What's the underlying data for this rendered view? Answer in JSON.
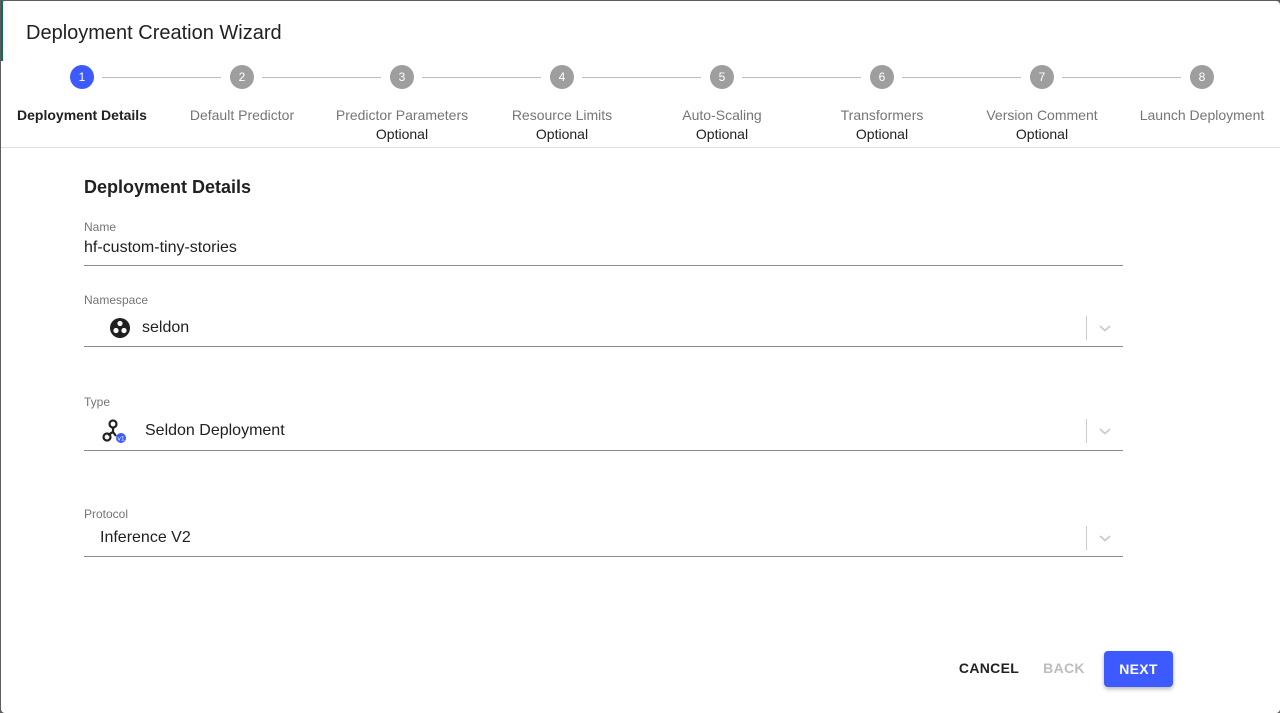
{
  "dialog": {
    "title": "Deployment Creation Wizard"
  },
  "stepper": {
    "optional_label": "Optional",
    "steps": [
      {
        "number": "1",
        "label": "Deployment Details",
        "optional": false,
        "active": true
      },
      {
        "number": "2",
        "label": "Default Predictor",
        "optional": false,
        "active": false
      },
      {
        "number": "3",
        "label": "Predictor Parameters",
        "optional": true,
        "active": false
      },
      {
        "number": "4",
        "label": "Resource Limits",
        "optional": true,
        "active": false
      },
      {
        "number": "5",
        "label": "Auto-Scaling",
        "optional": true,
        "active": false
      },
      {
        "number": "6",
        "label": "Transformers",
        "optional": true,
        "active": false
      },
      {
        "number": "7",
        "label": "Version Comment",
        "optional": true,
        "active": false
      },
      {
        "number": "8",
        "label": "Launch Deployment",
        "optional": false,
        "active": false
      }
    ]
  },
  "form": {
    "section_title": "Deployment Details",
    "name": {
      "label": "Name",
      "value": "hf-custom-tiny-stories"
    },
    "namespace": {
      "label": "Namespace",
      "value": "seldon",
      "icon": "namespace-icon"
    },
    "type": {
      "label": "Type",
      "value": "Seldon Deployment",
      "icon": "seldon-deployment-icon"
    },
    "protocol": {
      "label": "Protocol",
      "value": "Inference V2"
    }
  },
  "actions": {
    "cancel": "CANCEL",
    "back": "BACK",
    "next": "NEXT"
  },
  "colors": {
    "accent": "#3d5afe",
    "inactive_step": "#9e9e9e"
  }
}
